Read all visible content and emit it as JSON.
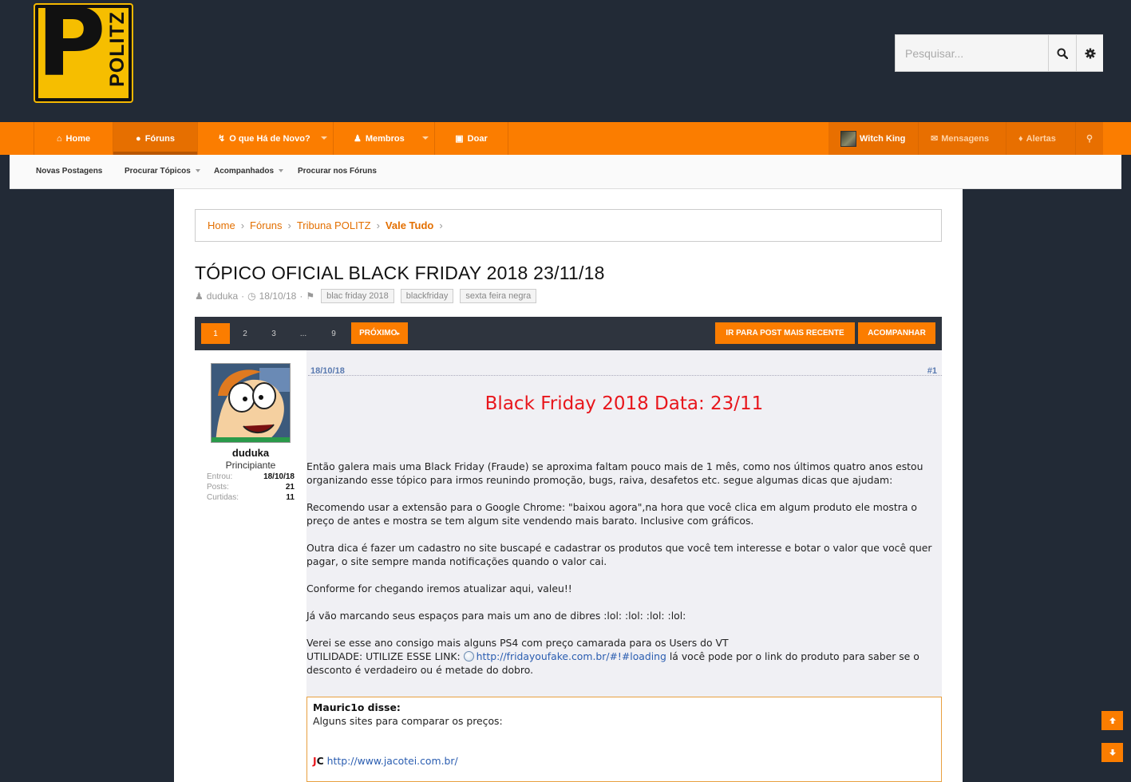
{
  "header": {
    "logo_text": "POLITZ",
    "logo_letter": "P",
    "search": {
      "placeholder": "Pesquisar..."
    }
  },
  "nav": {
    "tabs": [
      {
        "label": "Home",
        "icon": "home-icon"
      },
      {
        "label": "Fóruns",
        "icon": "comments-icon"
      },
      {
        "label": "O que Há de Novo?",
        "icon": "bolt-icon"
      },
      {
        "label": "Membros",
        "icon": "users-icon"
      },
      {
        "label": "Doar",
        "icon": "money-icon"
      }
    ],
    "account": {
      "username": "Witch King",
      "messages": "Mensagens",
      "alerts": "Alertas"
    }
  },
  "subnav": {
    "items": [
      "Novas Postagens",
      "Procurar Tópicos",
      "Acompanhados",
      "Procurar nos Fóruns"
    ]
  },
  "breadcrumb": [
    "Home",
    "Fóruns",
    "Tribuna POLITZ",
    "Vale Tudo"
  ],
  "thread": {
    "title": "TÓPICO OFICIAL BLACK FRIDAY 2018 23/11/18",
    "author": "duduka",
    "date": "18/10/18",
    "tags": [
      "blac friday 2018",
      "blackfriday",
      "sexta feira negra"
    ]
  },
  "pagination": {
    "pages": [
      "1",
      "2",
      "3",
      "...",
      "9"
    ],
    "current": "1",
    "next_label": "PRÓXIMO",
    "latest_label": "IR PARA POST MAIS RECENTE",
    "watch_label": "ACOMPANHAR"
  },
  "post": {
    "user": {
      "name": "duduka",
      "title": "Principiante",
      "stats": [
        {
          "label": "Entrou:",
          "value": "18/10/18"
        },
        {
          "label": "Posts:",
          "value": "21"
        },
        {
          "label": "Curtidas:",
          "value": "11"
        }
      ]
    },
    "date": "18/10/18",
    "number": "#1",
    "headline": "Black Friday 2018 Data: 23/11",
    "paragraphs": [
      "Então galera mais uma Black Friday (Fraude) se aproxima faltam pouco mais de 1 mês, como nos últimos quatro anos estou organizando esse tópico para irmos reunindo promoção, bugs, raiva, desafetos etc. segue algumas dicas que ajudam:",
      "Recomendo usar a extensão para o Google Chrome: \"baixou agora\",na hora que você clica em algum produto ele mostra o preço de antes e mostra se tem algum site vendendo mais barato. Inclusive com gráficos.",
      "Outra dica é fazer um cadastro no site buscapé e cadastrar os produtos que você tem interesse e botar o valor que você quer pagar, o site sempre manda notificações quando o valor cai.",
      "Conforme for chegando iremos atualizar aqui, valeu!!",
      "Já vão marcando seus espaços para mais um ano de dibres :lol: :lol: :lol: :lol:"
    ],
    "ps4_line": "Verei se esse ano consigo mais alguns PS4 com preço camarada para os Users do VT",
    "utility_prefix": "UTILIDADE: UTILIZE ESSE LINK:",
    "utility_link": "http://fridayoufake.com.br/#!#loading",
    "utility_suffix": " lá você pode por o link do produto para saber se o desconto é verdadeiro ou é metade do dobro.",
    "quote": {
      "author": "Mauric1o disse:",
      "text": "Alguns sites para comparar os preços:",
      "logo_j": "J",
      "logo_c": "C",
      "link": "http://www.jacotei.com.br/"
    }
  },
  "colors": {
    "accent": "#fb7d00",
    "background": "#222a36",
    "headline": "#e8161c",
    "link": "#2a5db0"
  }
}
